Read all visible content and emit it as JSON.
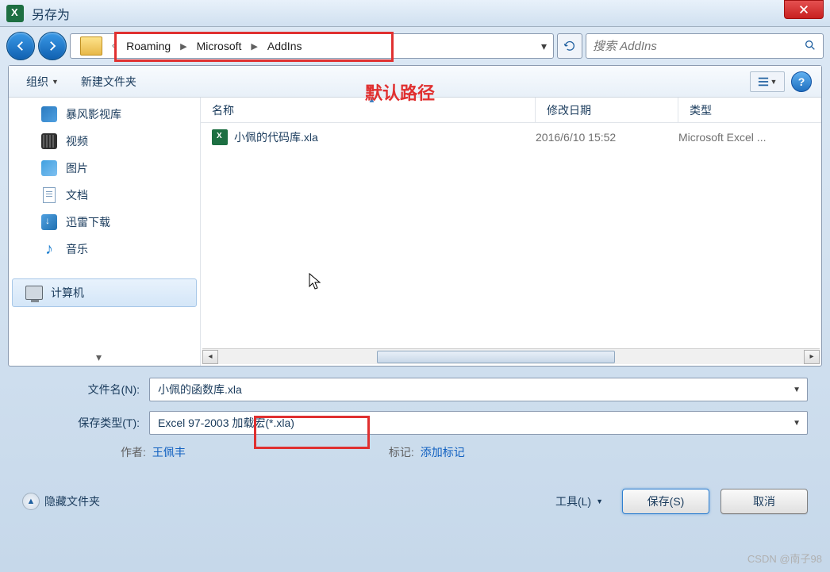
{
  "title": "另存为",
  "breadcrumb": {
    "items": [
      "Roaming",
      "Microsoft",
      "AddIns"
    ]
  },
  "search": {
    "placeholder": "搜索 AddIns"
  },
  "toolbar": {
    "organize": "组织",
    "newfolder": "新建文件夹"
  },
  "sidebar": {
    "items": [
      {
        "label": "暴风影视库"
      },
      {
        "label": "视频"
      },
      {
        "label": "图片"
      },
      {
        "label": "文档"
      },
      {
        "label": "迅雷下载"
      },
      {
        "label": "音乐"
      },
      {
        "label": "计算机"
      }
    ]
  },
  "columns": {
    "name": "名称",
    "date": "修改日期",
    "type": "类型"
  },
  "files": [
    {
      "name": "小佩的代码库.xla",
      "date": "2016/6/10 15:52",
      "type": "Microsoft Excel ..."
    }
  ],
  "form": {
    "filename_label": "文件名(N):",
    "filename_value": "小佩的函数库.xla",
    "filetype_label": "保存类型(T):",
    "filetype_value": "Excel 97-2003 加载宏(*.xla)",
    "author_label": "作者:",
    "author_value": "王佩丰",
    "tag_label": "标记:",
    "tag_value": "添加标记"
  },
  "actions": {
    "hide_folders": "隐藏文件夹",
    "tools": "工具(L)",
    "save": "保存(S)",
    "cancel": "取消"
  },
  "annotation": {
    "default_path": "默认路径"
  },
  "watermark": "CSDN @南子98"
}
